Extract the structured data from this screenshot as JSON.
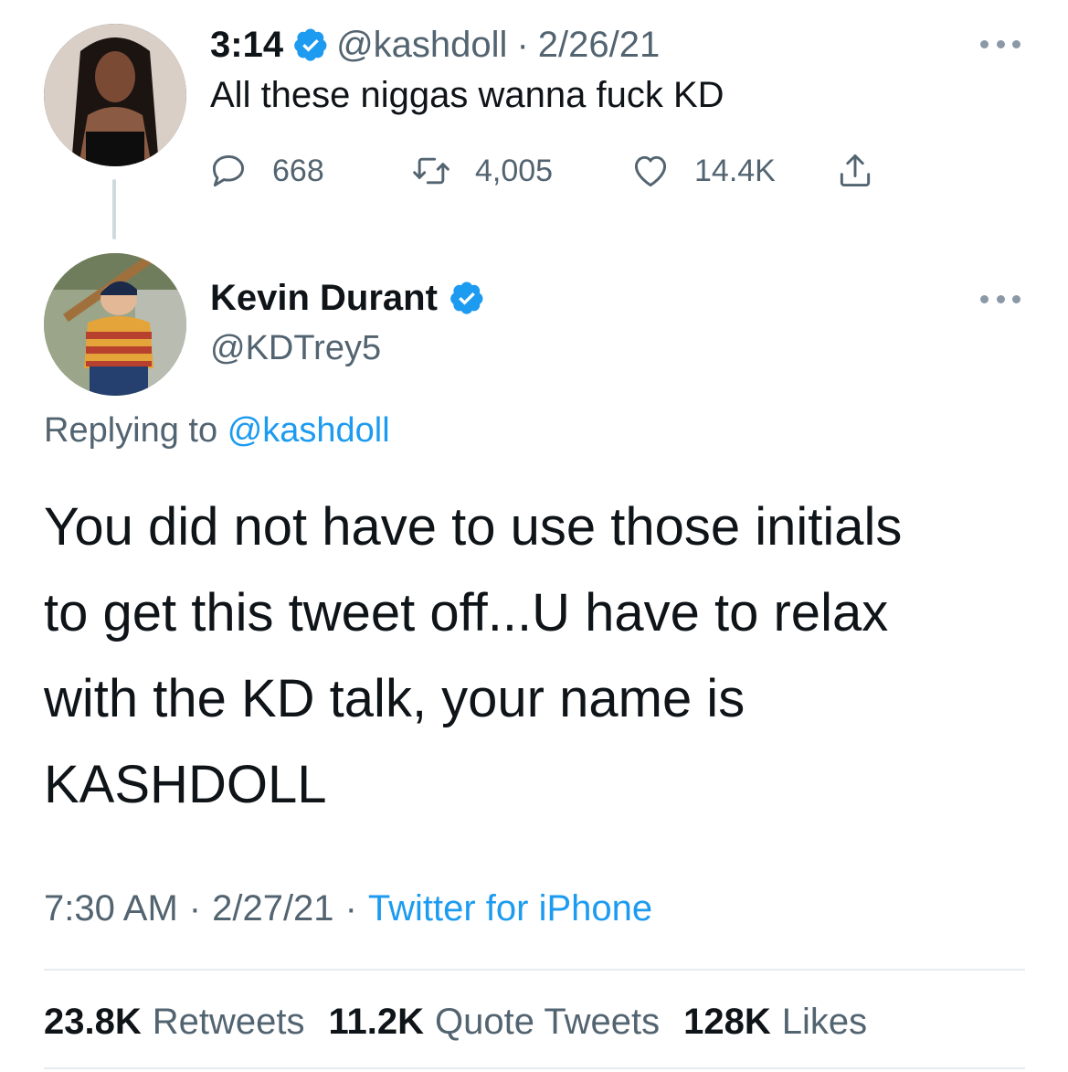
{
  "parent_tweet": {
    "display_name": "3:14",
    "handle": "@kashdoll",
    "separator": "·",
    "date": "2/26/21",
    "text": "All these niggas wanna fuck KD",
    "counts": {
      "replies": "668",
      "retweets": "4,005",
      "likes": "14.4K"
    }
  },
  "main_tweet": {
    "display_name": "Kevin Durant",
    "handle": "@KDTrey5",
    "replying_prefix": "Replying to",
    "replying_handle": "@kashdoll",
    "text_lines": [
      "You did not have to use those initials",
      "to get this tweet off...U have to relax",
      "with the KD talk, your name is",
      "KASHDOLL"
    ],
    "time": "7:30 AM",
    "date": "2/27/21",
    "separator": "·",
    "source": "Twitter for iPhone",
    "stats": {
      "retweets_count": "23.8K",
      "retweets_label": "Retweets",
      "quotes_count": "11.2K",
      "quotes_label": "Quote Tweets",
      "likes_count": "128K",
      "likes_label": "Likes"
    }
  },
  "colors": {
    "text_primary": "#0f1419",
    "text_secondary": "#536471",
    "link": "#1d9bf0",
    "verified": "#1d9bf0"
  },
  "icons": {
    "reply": "speech-bubble-icon",
    "retweet": "retweet-arrows-icon",
    "like": "heart-icon",
    "share": "share-upload-icon",
    "more": "ellipsis-icon",
    "verified": "verified-badge-icon"
  }
}
